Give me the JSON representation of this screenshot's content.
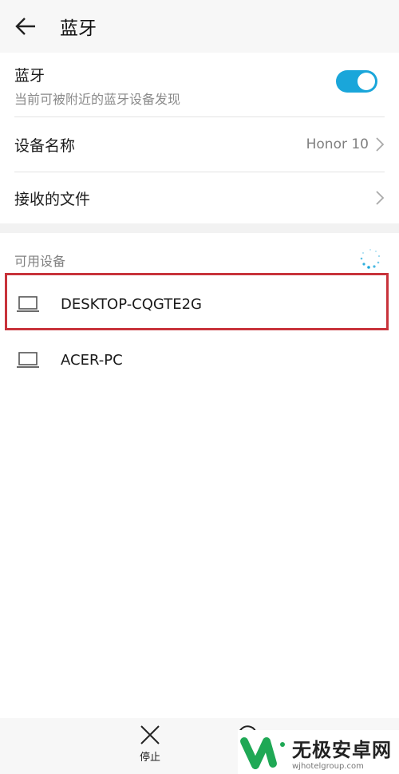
{
  "header": {
    "title": "蓝牙",
    "back_icon": "arrow-left-icon"
  },
  "bluetooth": {
    "label": "蓝牙",
    "subtitle": "当前可被附近的蓝牙设备发现",
    "enabled": true,
    "accent": "#1aa6da"
  },
  "device_name": {
    "label": "设备名称",
    "value": "Honor 10"
  },
  "received_files": {
    "label": "接收的文件"
  },
  "available": {
    "title": "可用设备",
    "devices": [
      {
        "name": "DESKTOP-CQGTE2G",
        "icon": "laptop-icon",
        "highlighted": true
      },
      {
        "name": "ACER-PC",
        "icon": "laptop-icon"
      }
    ],
    "highlight_color": "#c8333b"
  },
  "bottom": {
    "stop_label": "停止"
  },
  "watermark": {
    "title": "无极安卓网",
    "url": "wjhotelgroup.com"
  }
}
